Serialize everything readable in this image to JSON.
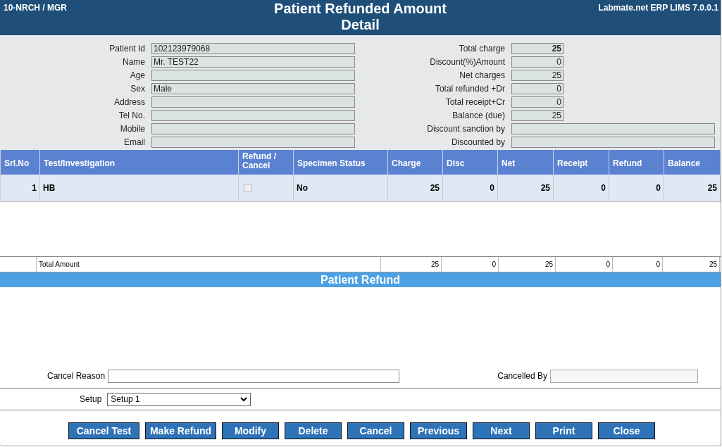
{
  "header": {
    "left": "10-NRCH / MGR",
    "title": "Patient Refunded Amount Detail",
    "right": "Labmate.net ERP LIMS 7.0.0.1"
  },
  "patient_fields": [
    {
      "label": "Patient Id",
      "value": "102123979068"
    },
    {
      "label": "Name",
      "value": "Mr. TEST22"
    },
    {
      "label": "Age"
    },
    {
      "label": "Sex",
      "value": "Male"
    },
    {
      "label": "Address"
    },
    {
      "label": "Tel No."
    },
    {
      "label": "Mobile"
    },
    {
      "label": "Email"
    }
  ],
  "amount_fields": [
    {
      "label": "Total charge",
      "value": "25",
      "kind": "short",
      "bold": true
    },
    {
      "label": "Discount(%)Amount",
      "value": "0",
      "kind": "short",
      "bold": false
    },
    {
      "label": "Net charges",
      "value": "25",
      "kind": "short",
      "bold": false
    },
    {
      "label": "Total refunded +Dr",
      "value": "0",
      "kind": "short",
      "bold": false
    },
    {
      "label": "Total receipt+Cr",
      "value": "0",
      "kind": "short",
      "bold": false
    },
    {
      "label": "Balance (due)",
      "value": "25",
      "kind": "short",
      "bold": false
    },
    {
      "label": "Discount sanction by",
      "kind": "long"
    },
    {
      "label": "Discounted by",
      "kind": "long"
    }
  ],
  "table": {
    "columns": [
      "Srl.No",
      "Test/Investigation",
      "Refund / Cancel",
      "Specimen Status",
      "Charge",
      "Disc",
      "Net",
      "Receipt",
      "Refund",
      "Balance"
    ],
    "rows": [
      {
        "srl": "1",
        "test": "HB",
        "refund_cancel": {
          "checked": false,
          "disabled": true
        },
        "specimen_status": "No",
        "charge": "25",
        "disc": "0",
        "net": "25",
        "receipt": "0",
        "refund": "0",
        "balance": "25"
      }
    ],
    "totals": {
      "label": "Total Amount",
      "values": [
        "25",
        "0",
        "25",
        "0",
        "0",
        "25"
      ]
    }
  },
  "refund_section": {
    "title": "Patient Refund"
  },
  "cancel_reason": {
    "label": "Cancel Reason"
  },
  "cancelled_by": {
    "label": "Cancelled By"
  },
  "setup": {
    "label": "Setup",
    "value": "Setup 1"
  },
  "buttons": [
    "Cancel Test",
    "Make Refund",
    "Modify",
    "Delete",
    "Cancel",
    "Previous",
    "Next",
    "Print",
    "Close"
  ]
}
